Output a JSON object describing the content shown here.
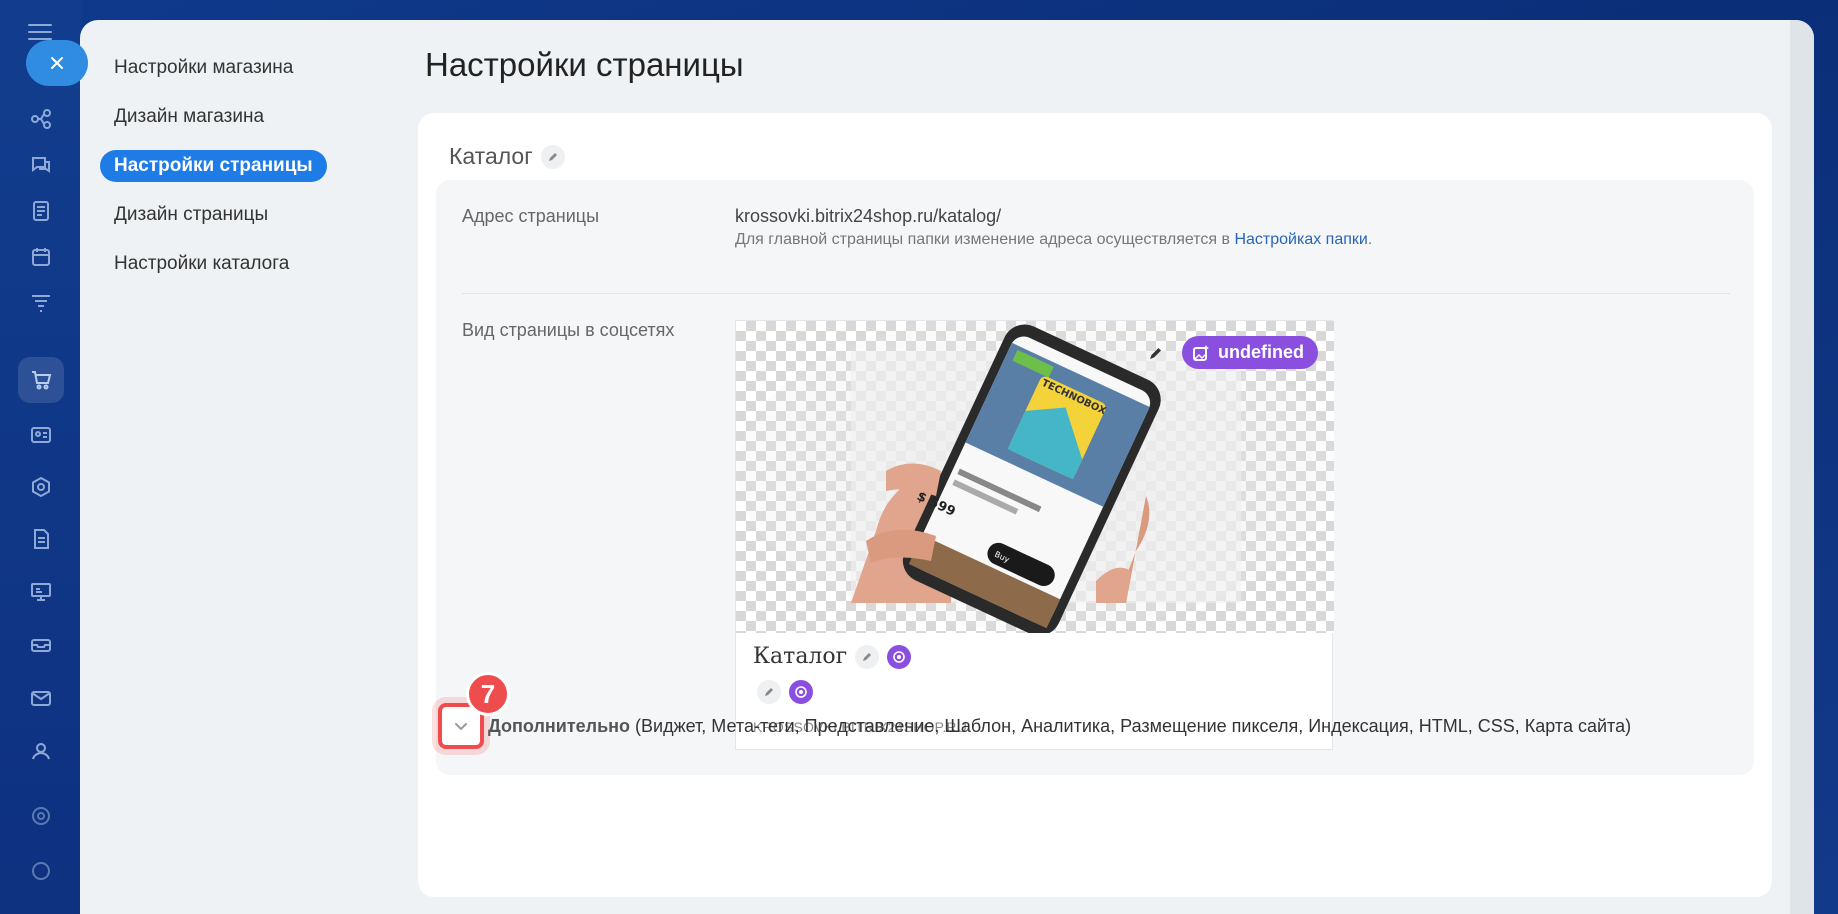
{
  "page": {
    "title": "Настройки страницы"
  },
  "nav": {
    "items": [
      {
        "label": "Настройки магазина",
        "active": false
      },
      {
        "label": "Дизайн магазина",
        "active": false
      },
      {
        "label": "Настройки страницы",
        "active": true
      },
      {
        "label": "Дизайн страницы",
        "active": false
      },
      {
        "label": "Настройки каталога",
        "active": false
      }
    ]
  },
  "card": {
    "title": "Каталог",
    "address_label": "Адрес страницы",
    "address_value": "krossovki.bitrix24shop.ru/katalog/",
    "address_hint": "Для главной страницы папки изменение адреса осуществляется в ",
    "address_hint_link": "Настройках папки",
    "address_hint_end": ".",
    "social_label": "Вид страницы в соцсетях"
  },
  "preview": {
    "badge_label": "undefined",
    "title": "Каталог",
    "domain": "KROSSOVKI.BITRIX24SHOP.RU",
    "photo_brand": "TECHNOBOX",
    "photo_price": "$ 599",
    "photo_button": "Buy"
  },
  "extra": {
    "step_number": "7",
    "label": "Дополнительно",
    "details": " (Виджет,  Мета-теги,  Представление,  Шаблон,  Аналитика,  Размещение пикселя,  Индексация,  HTML,  CSS,  Карта сайта)"
  },
  "colors": {
    "accent": "#1f7be6",
    "ai_purple": "#8b4fe0",
    "highlight_red": "#ef4d4d",
    "link": "#2a66b5"
  },
  "icons": {
    "rail": [
      "menu-icon",
      "close-icon",
      "flow-icon",
      "chat-icon",
      "tasks-icon",
      "calendar-icon",
      "funnel-icon",
      "cart-icon",
      "contacts-icon",
      "hexagon-icon",
      "document-icon",
      "presentation-icon",
      "inbox-icon",
      "mail-icon",
      "people-icon",
      "settings-icon"
    ],
    "edit": "pencil-icon",
    "ai": "ai-sparkle-icon",
    "expand": "chevron-down-icon"
  }
}
